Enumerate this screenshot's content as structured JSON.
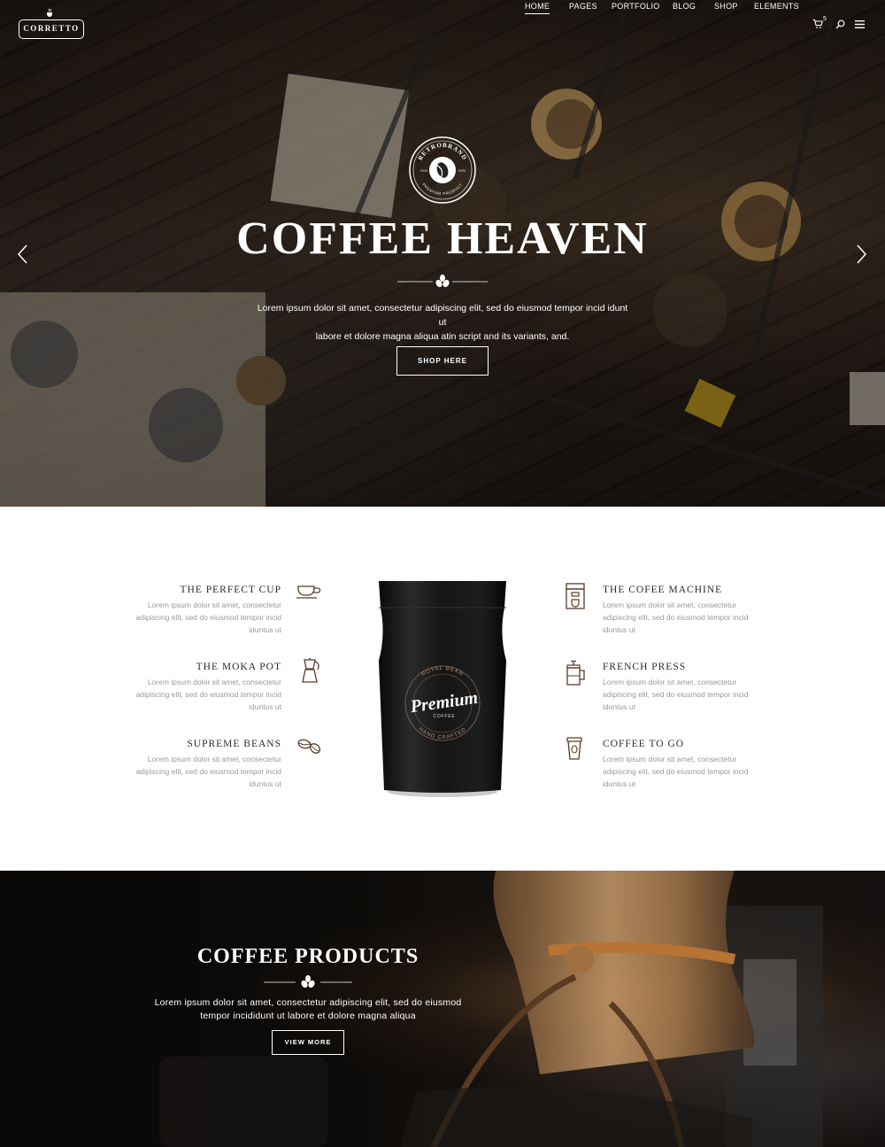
{
  "header": {
    "logo_text": "CORRETTO",
    "nav": [
      "HOME",
      "PAGES",
      "PORTFOLIO",
      "BLOG",
      "SHOP",
      "ELEMENTS"
    ],
    "active_nav": "HOME",
    "cart_count": "5",
    "icons": [
      "cart-icon",
      "search-icon",
      "menu-icon"
    ]
  },
  "hero": {
    "badge": {
      "top_text": "RETROBRAND",
      "bottom_text": "PREMIUM PRODUCT",
      "left_mark": "XXXI",
      "right_mark": "XXXI"
    },
    "title": "COFFEE HEAVEN",
    "text_line1": "Lorem ipsum dolor sit amet, consectetur adipiscing elit, sed do eiusmod tempor incid idunt ut",
    "text_line2": "labore et dolore magna aliqua atin script and its variants, and.",
    "button": "SHOP HERE"
  },
  "features": {
    "left": [
      {
        "title": "THE PERFECT CUP",
        "icon": "cup-icon",
        "lines": [
          "Lorem ipsum dolor sit amet, consectetur",
          "adipiscing elit, sed do eiusmod tempor incid",
          "iduntus ut"
        ]
      },
      {
        "title": "THE MOKA POT",
        "icon": "moka-pot-icon",
        "lines": [
          "Lorem ipsum dolor sit amet, consectetur",
          "adipiscing elit, sed do eiusmod tempor incid",
          "iduntus ut"
        ]
      },
      {
        "title": "SUPREME BEANS",
        "icon": "coffee-beans-icon",
        "lines": [
          "Lorem ipsum dolor sit amet, consectetur",
          "adipiscing elit, sed do eiusmod tempor incid",
          "iduntus ut"
        ]
      }
    ],
    "right": [
      {
        "title": "THE COFEE MACHINE",
        "icon": "coffee-machine-icon",
        "lines": [
          "Lorem ipsum dolor sit amet, consectetur",
          "adipiscing elit, sed do eiusmod tempor incid",
          "iduntus ut"
        ]
      },
      {
        "title": "FRENCH PRESS",
        "icon": "french-press-icon",
        "lines": [
          "Lorem ipsum dolor sit amet, consectetur",
          "adipiscing elit, sed do eiusmod tempor incid",
          "iduntus ut"
        ]
      },
      {
        "title": "COFFEE TO GO",
        "icon": "to-go-cup-icon",
        "lines": [
          "Lorem ipsum dolor sit amet, consectetur",
          "adipiscing elit, sed do eiusmod tempor incid",
          "iduntus ut"
        ]
      }
    ],
    "pouch": {
      "script_text": "Premium",
      "small_text": "COFFEE",
      "ring_top": "ROYAL BEAN",
      "ring_bottom": "HAND CRAFTED"
    }
  },
  "products": {
    "title": "COFFEE PRODUCTS",
    "text_line1": "Lorem ipsum dolor sit amet, consectetur adipiscing elit, sed do eiusmod",
    "text_line2": "tempor incididunt ut labore et dolore magna aliqua",
    "button": "VIEW MORE"
  },
  "colors": {
    "accent_brown": "#5b3a2a",
    "feature_title": "#2b2b2b",
    "feature_text": "#999999"
  }
}
